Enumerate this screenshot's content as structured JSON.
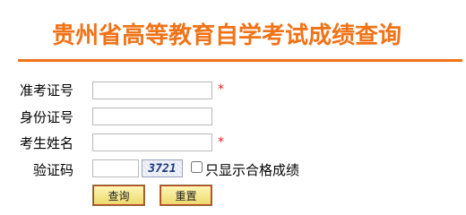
{
  "title": "贵州省高等教育自学考试成绩查询",
  "fields": [
    {
      "label": "准考证号",
      "value": "",
      "required_mark": "*"
    },
    {
      "label": "身份证号",
      "value": ""
    },
    {
      "label": "考生姓名",
      "value": "",
      "required_mark": "*"
    },
    {
      "label": "验证码",
      "value": ""
    }
  ],
  "captcha_text": "3721",
  "checkbox_label": "只显示合格成绩",
  "checkbox_checked": false,
  "buttons": {
    "query": "查询",
    "reset": "重置"
  },
  "colors": {
    "accent": "#f07318",
    "required": "#e02020",
    "button_bg": "#f3e07a"
  }
}
